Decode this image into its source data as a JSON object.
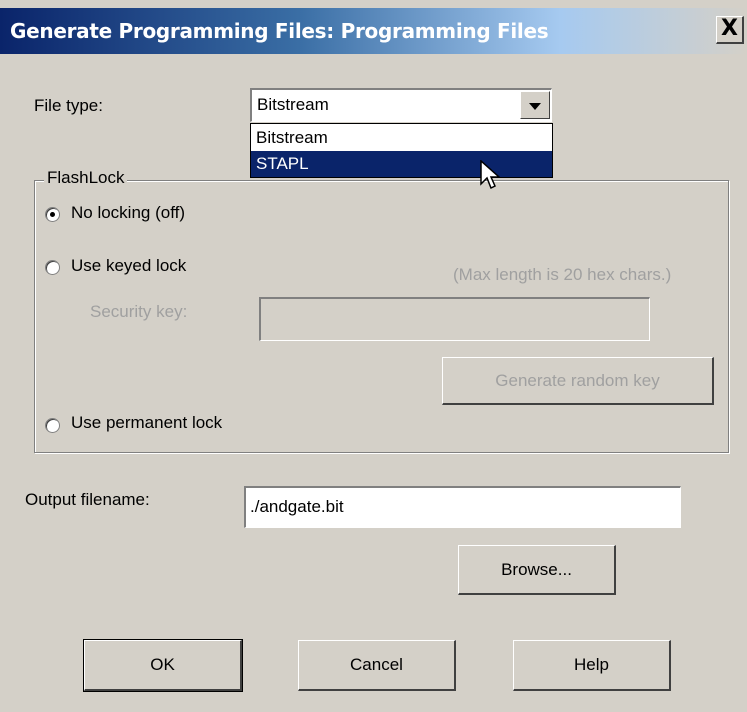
{
  "window": {
    "title": "Generate Programming Files: Programming Files",
    "close_label": "X"
  },
  "file_type": {
    "label": "File type:",
    "selected": "Bitstream",
    "options": [
      "Bitstream",
      "STAPL"
    ],
    "highlighted_option": "STAPL"
  },
  "flashlock": {
    "title": "FlashLock",
    "no_locking_label": "No locking (off)",
    "keyed_lock_label": "Use keyed lock",
    "max_length_note": "(Max length is 20 hex chars.)",
    "security_key_label": "Security key:",
    "security_key_value": "",
    "generate_key_button": "Generate random key",
    "permanent_lock_label": "Use permanent lock",
    "selected_option": "no_locking"
  },
  "output": {
    "label": "Output filename:",
    "value": "./andgate.bit",
    "browse_button": "Browse..."
  },
  "buttons": {
    "ok": "OK",
    "cancel": "Cancel",
    "help": "Help"
  },
  "colors": {
    "dialog_bg": "#d4d0c8",
    "title_gradient_start": "#0a246a",
    "title_gradient_end": "#a6caf0",
    "selection": "#0a246a",
    "disabled_text": "#a0a0a0"
  }
}
